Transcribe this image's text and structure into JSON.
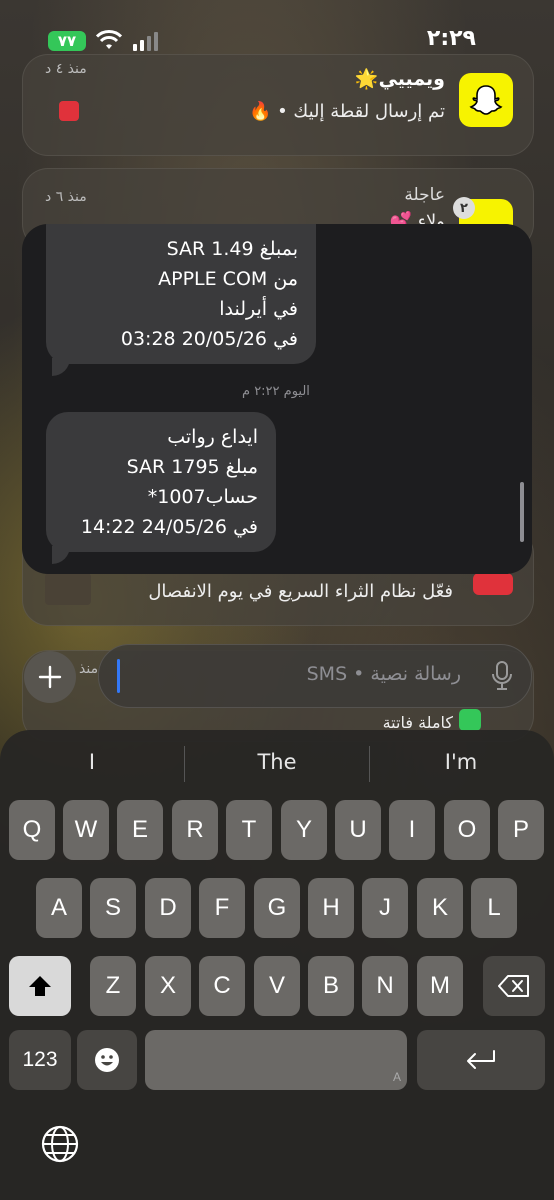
{
  "status_bar": {
    "time": "٢:٢٩",
    "battery": "٧٧"
  },
  "notifications": [
    {
      "app": "Snapchat",
      "title": "ويمييي🌟",
      "body": "تم إرسال لقطة إليك • 🔥",
      "time": "منذ ٤ د"
    },
    {
      "app": "Snapchat",
      "title": "عاجلة",
      "body": "ولاء 💕",
      "time": "منذ ٦ د",
      "badge": "٢"
    },
    {
      "body": "فعّل نظام الثراء السريع في يوم الانفصال"
    },
    {
      "title": "منذ",
      "body": "كاملة فاتتة"
    }
  ],
  "messages": [
    {
      "lines": [
        "بمبلغ SAR 1.49",
        "من APPLE COM",
        "في أيرلندا",
        "في 20/05/26 03:28"
      ]
    },
    {
      "timestamp": "اليوم ٢:٢٢ م"
    },
    {
      "lines": [
        "ايداع رواتب",
        "مبلغ SAR 1795",
        "حساب1007*",
        "في 24/05/26 14:22"
      ]
    }
  ],
  "composer": {
    "placeholder": "رسالة نصية • SMS"
  },
  "keyboard": {
    "suggestions": [
      "I",
      "The",
      "I'm"
    ],
    "row1": [
      "Q",
      "W",
      "E",
      "R",
      "T",
      "Y",
      "U",
      "I",
      "O",
      "P"
    ],
    "row2": [
      "A",
      "S",
      "D",
      "F",
      "G",
      "H",
      "J",
      "K",
      "L"
    ],
    "row3": [
      "Z",
      "X",
      "C",
      "V",
      "B",
      "N",
      "M"
    ],
    "numbers_label": "123",
    "space_hint": "A"
  }
}
